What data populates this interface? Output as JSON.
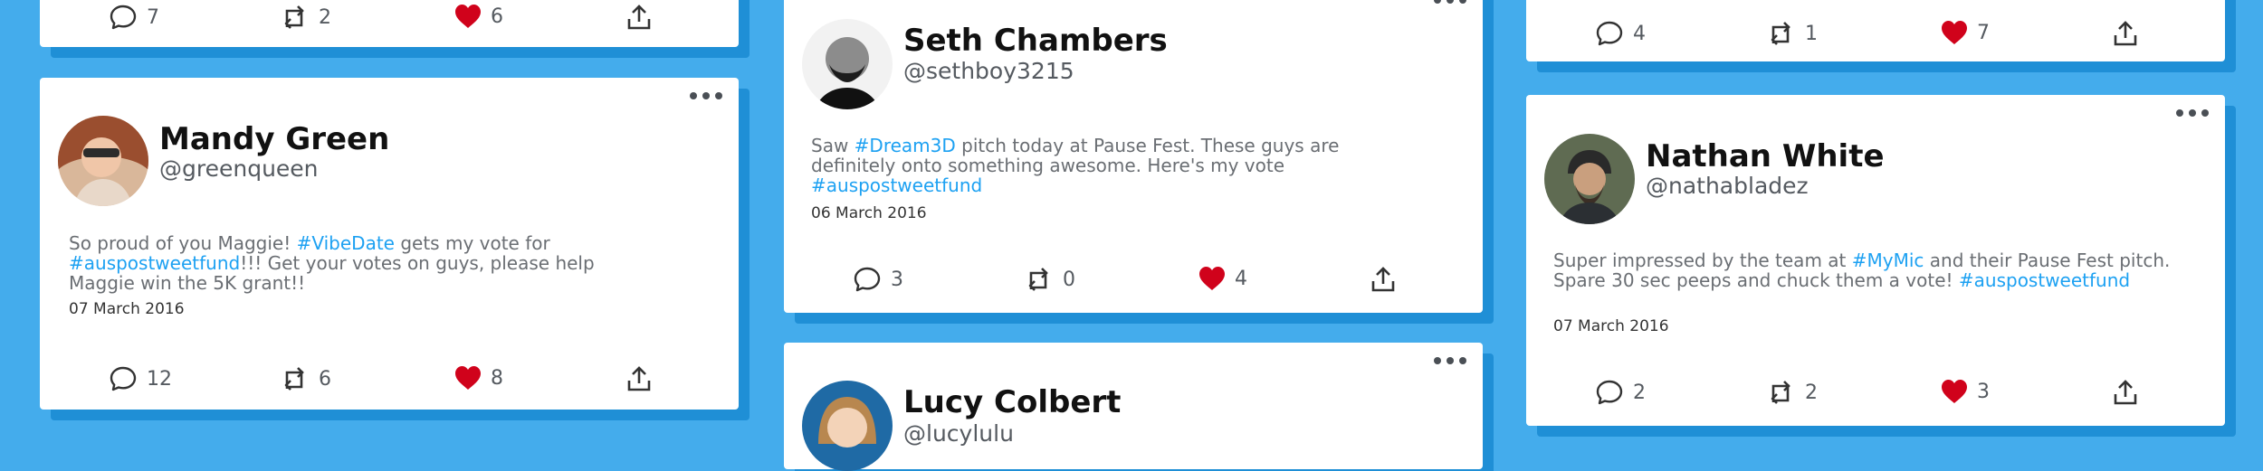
{
  "cards": [
    {
      "name": "",
      "handle": "",
      "date": "",
      "stats": {
        "comments": "7",
        "retweets": "2",
        "likes": "6"
      }
    },
    {
      "name": "Mandy Green",
      "handle": "@greenqueen",
      "text": [
        "So proud of you Maggie! ",
        "#VibeDate",
        " gets my vote for ",
        "#auspostweetfund",
        "!!! Get your votes on guys, please help Maggie win the 5K grant!!"
      ],
      "date": "07 March 2016",
      "stats": {
        "comments": "12",
        "retweets": "6",
        "likes": "8"
      }
    },
    {
      "name": "Seth Chambers",
      "handle": "@sethboy3215",
      "text": [
        "Saw ",
        "#Dream3D",
        " pitch today at Pause Fest. These guys are definitely onto something awesome. Here's my vote ",
        "#auspostweetfund",
        ""
      ],
      "date": "06 March 2016",
      "stats": {
        "comments": "3",
        "retweets": "0",
        "likes": "4"
      }
    },
    {
      "name": "Lucy Colbert",
      "handle": "@lucylulu"
    },
    {
      "stats": {
        "comments": "4",
        "retweets": "1",
        "likes": "7"
      }
    },
    {
      "name": "Nathan White",
      "handle": "@nathabladez",
      "text": [
        "Super impressed by the team at ",
        "#MyMic",
        " and their Pause Fest pitch. Spare 30 sec peeps and chuck them a vote! ",
        "#auspostweetfund",
        ""
      ],
      "date": "07 March 2016",
      "stats": {
        "comments": "2",
        "retweets": "2",
        "likes": "3"
      }
    }
  ],
  "colors": {
    "background": "#44acec",
    "card": "#ffffff",
    "shadow": "#1f8fd6",
    "hashtag": "#1da1f2",
    "like": "#d0021b"
  },
  "icons": {
    "comment": "comment-icon",
    "retweet": "retweet-icon",
    "like": "heart-icon",
    "share": "share-icon",
    "menu": "more-options-icon"
  }
}
